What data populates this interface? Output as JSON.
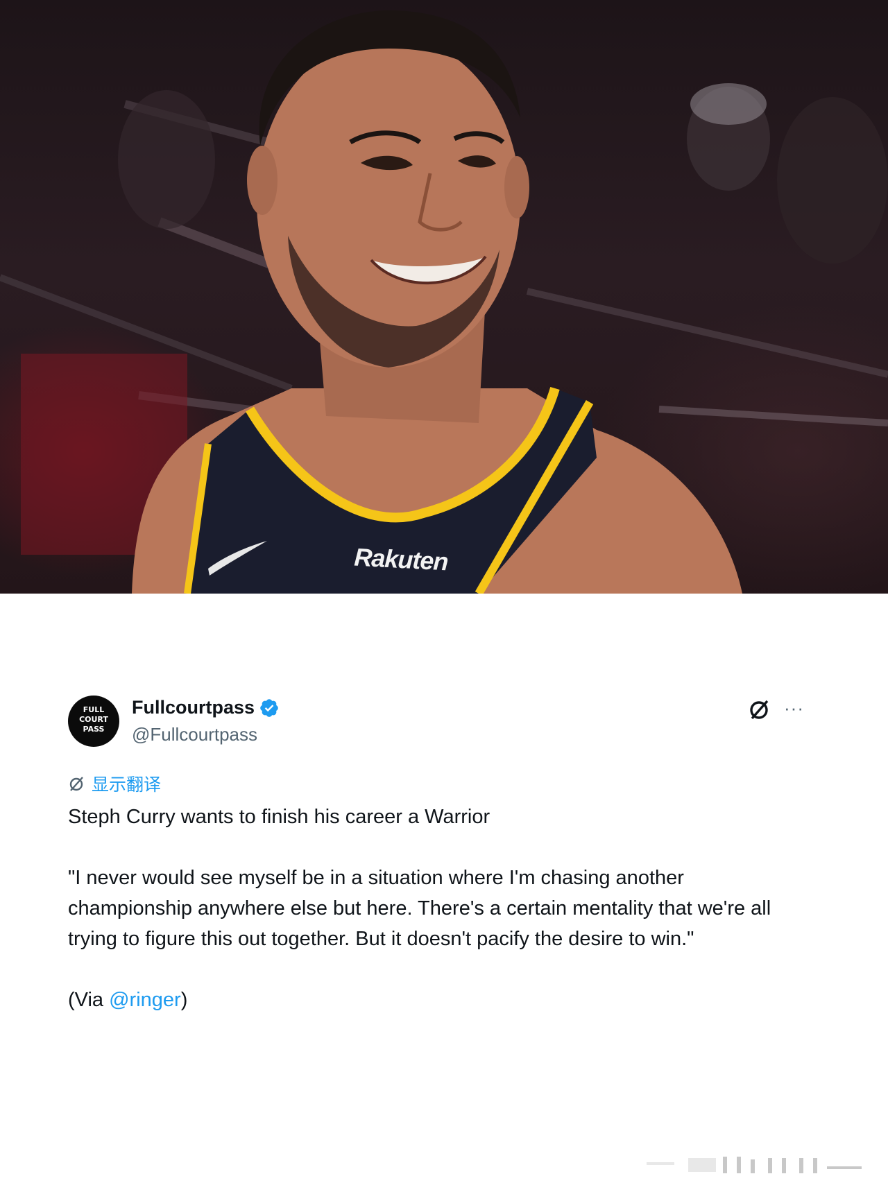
{
  "photo": {
    "description_label": "Stephen Curry smiling in Golden State Warriors jersey",
    "jersey_sponsor": "Rakuten"
  },
  "tweet": {
    "author": {
      "display_name": "Fullcourtpass",
      "handle": "@Fullcourtpass",
      "verified": true,
      "avatar_text": "FULL COURT PASS"
    },
    "actions": {
      "translate_icon": "translate-icon",
      "more_label": "···"
    },
    "show_translation_label": "显示翻译",
    "headline": "Steph Curry wants to finish his career a Warrior",
    "quote": "\"I never would see myself be in a situation where I'm chasing another championship anywhere else but here. There's a certain mentality that we're all trying to figure this out together. But it doesn't pacify the desire to win.\"",
    "via_prefix": "(Via ",
    "via_mention": "@ringer",
    "via_suffix": ")"
  },
  "colors": {
    "link": "#1d9bf0",
    "secondary_text": "#536471",
    "primary_text": "#0f1419",
    "jersey_yellow": "#f5c518",
    "jersey_navy": "#1a1d2e"
  }
}
